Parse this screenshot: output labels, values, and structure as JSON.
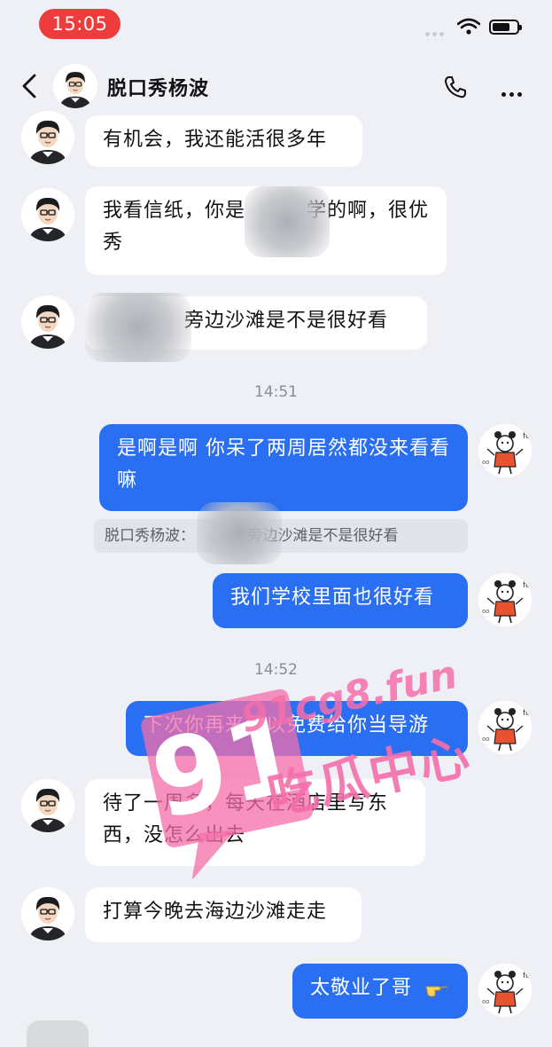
{
  "status_bar": {
    "time": "15:05"
  },
  "header": {
    "contact_name": "脱口秀杨波"
  },
  "messages": [
    {
      "from": "them",
      "text": "有机会，我还能活很多年"
    },
    {
      "from": "them",
      "text": "我看信纸，你是　　　学的啊，很优秀"
    },
    {
      "from": "them",
      "text": "　　　　旁边沙滩是不是很好看"
    },
    {
      "type": "time",
      "text": "14:51"
    },
    {
      "from": "me",
      "text": "是啊是啊 你呆了两周居然都没来看看嘛"
    },
    {
      "type": "quote",
      "text": "脱口秀杨波：　　　　旁边沙滩是不是很好看"
    },
    {
      "from": "me",
      "text": "我们学校里面也很好看"
    },
    {
      "type": "time",
      "text": "14:52"
    },
    {
      "from": "me",
      "text": "下次你再来可以免费给你当导游"
    },
    {
      "from": "them",
      "text": "待了一周多，每天在酒店里写东西，没怎么出去"
    },
    {
      "from": "them",
      "text": "打算今晚去海边沙滩走走"
    },
    {
      "from": "me",
      "text": "太敬业了哥"
    }
  ],
  "watermark": {
    "url": "91cg8.fun",
    "text": "吃瓜中心",
    "badge": "91"
  },
  "colors": {
    "accent": "#2a6ff2",
    "time_pill": "#ee3b3b",
    "watermark": "#f46eaa"
  }
}
